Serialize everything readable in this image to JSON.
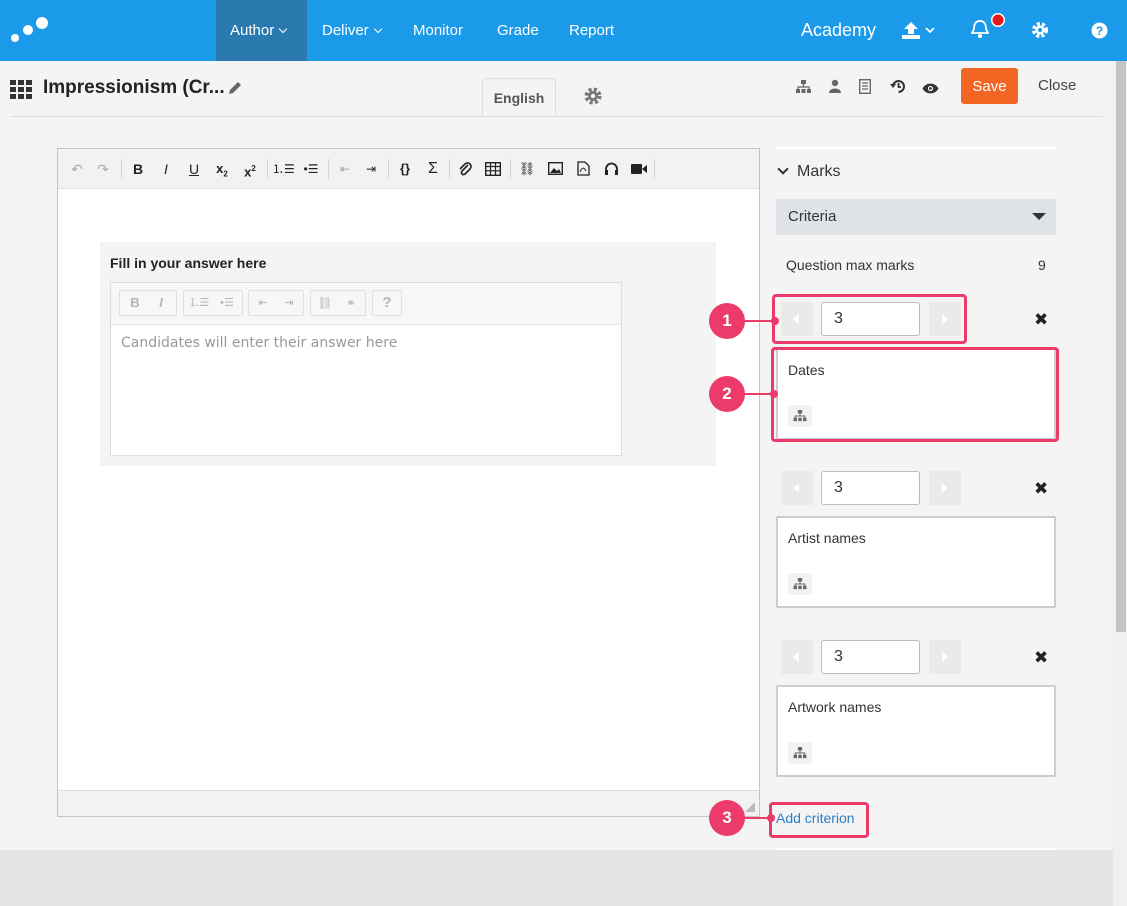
{
  "nav": {
    "items": [
      {
        "label": "Author",
        "active": true,
        "dropdown": true
      },
      {
        "label": "Deliver",
        "active": false,
        "dropdown": true
      },
      {
        "label": "Monitor",
        "active": false,
        "dropdown": false
      },
      {
        "label": "Grade",
        "active": false,
        "dropdown": false
      },
      {
        "label": "Report",
        "active": false,
        "dropdown": false
      }
    ],
    "org": "Academy",
    "icons": [
      "upload-icon",
      "bell-icon",
      "gear-icon",
      "help-icon"
    ],
    "bar_color": "#1a9ae8",
    "active_color": "#2a7ab0",
    "notification_color": "#e8151b"
  },
  "header": {
    "title": "Impressionism (Cr...",
    "language_tab": "English",
    "save_label": "Save",
    "close_label": "Close",
    "save_color": "#f26522",
    "icons": [
      "hierarchy-icon",
      "user-icon",
      "document-icon",
      "history-icon",
      "preview-eye-icon",
      "pencil-icon",
      "gear-icon",
      "apps-grid-icon"
    ]
  },
  "editor": {
    "answer_label": "Fill in your answer here",
    "placeholder": "Candidates will enter their answer here"
  },
  "marks": {
    "heading": "Marks",
    "scheme_select": "Criteria",
    "max_marks_label": "Question max marks",
    "max_marks_value": "9",
    "criteria": [
      {
        "mark": "3",
        "text": "Dates"
      },
      {
        "mark": "3",
        "text": "Artist names"
      },
      {
        "mark": "3",
        "text": "Artwork names"
      }
    ],
    "add_label": "Add criterion",
    "link_color": "#2b7fc4"
  },
  "annotations": [
    {
      "label": "1"
    },
    {
      "label": "2"
    },
    {
      "label": "3"
    }
  ],
  "annotation_color": "#ec3b6a"
}
